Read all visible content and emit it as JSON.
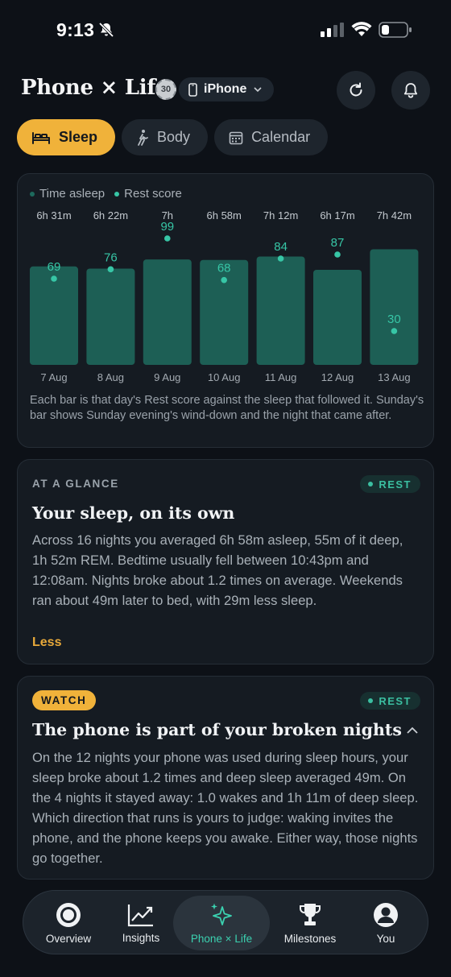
{
  "status_bar": {
    "time": "9:13"
  },
  "header": {
    "title": "Phone × Life",
    "seal_text": "30",
    "device": "iPhone"
  },
  "chips": [
    {
      "label": "Sleep",
      "icon": "bed-icon",
      "active": true
    },
    {
      "label": "Body",
      "icon": "walking-icon",
      "active": false
    },
    {
      "label": "Calendar",
      "icon": "calendar-icon",
      "active": false
    }
  ],
  "chart": {
    "legend": [
      "Time asleep",
      "Rest score"
    ],
    "note": "Each bar is that day's Rest score against the sleep that followed it. Sunday's bar shows Sunday evening's wind-down and the night that came after."
  },
  "chart_data": {
    "type": "bar",
    "categories": [
      "7 Aug",
      "8 Aug",
      "9 Aug",
      "10 Aug",
      "11 Aug",
      "12 Aug",
      "13 Aug"
    ],
    "series": [
      {
        "name": "Time asleep",
        "values_minutes": [
          391,
          382,
          420,
          418,
          432,
          377,
          462
        ],
        "labels": [
          "6h 31m",
          "6h 22m",
          "7h",
          "6h 58m",
          "7h 12m",
          "6h 17m",
          "7h 42m"
        ]
      },
      {
        "name": "Rest score",
        "values": [
          69,
          76,
          99,
          68,
          84,
          87,
          30
        ]
      }
    ],
    "colors": {
      "bar": "#1d5f55",
      "dot": "#37c6a6",
      "label": "#37c6a6"
    }
  },
  "glance": {
    "overline": "AT A GLANCE",
    "tag": "REST",
    "title": "Your sleep, on its own",
    "body": "Across 16 nights you averaged 6h 58m asleep, 55m of it deep, 1h 52m REM. Bedtime usually fell between 10:43pm and 12:08am. Nights broke about 1.2 times on average. Weekends ran about 49m later to bed, with 29m less sleep.",
    "less": "Less"
  },
  "watch": {
    "badge": "WATCH",
    "tag": "REST",
    "title": "The phone is part of your broken nights",
    "body": "On the 12 nights your phone was used during sleep hours, your sleep broke about 1.2 times and deep sleep averaged 49m. On the 4 nights it stayed away: 1.0 wakes and 1h 11m of deep sleep. Which direction that runs is yours to judge: waking invites the phone, and the phone keeps you awake. Either way, those nights go together."
  },
  "tabs": [
    {
      "label": "Overview",
      "icon": "overview-icon"
    },
    {
      "label": "Insights",
      "icon": "chart-line-icon"
    },
    {
      "label": "Phone × Life",
      "icon": "sparkle-icon",
      "active": true
    },
    {
      "label": "Milestones",
      "icon": "trophy-icon"
    },
    {
      "label": "You",
      "icon": "person-icon"
    }
  ]
}
